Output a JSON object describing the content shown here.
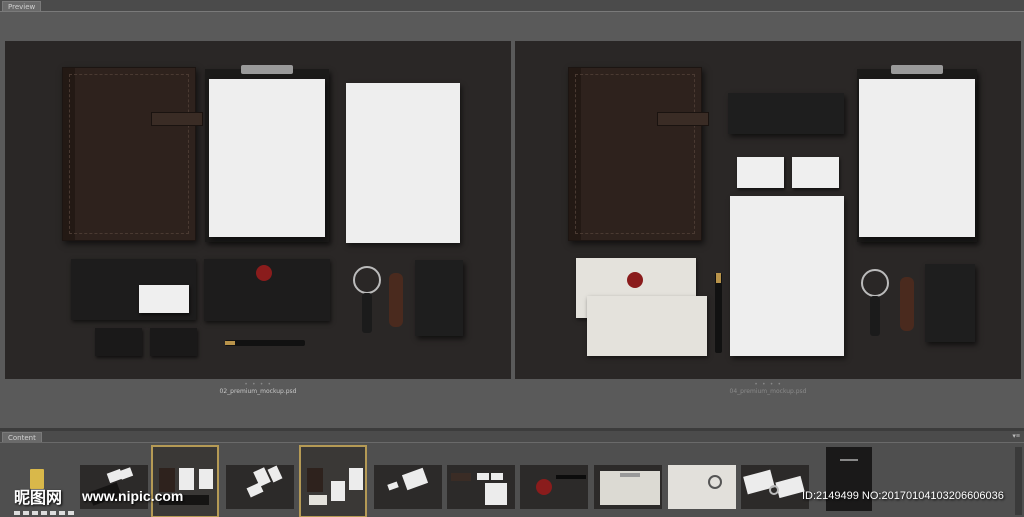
{
  "preview": {
    "tab_label": "Preview",
    "left_caption": "02_premium_mockup.psd",
    "right_caption": "04_premium_mockup.psd",
    "dots": "• • • •"
  },
  "content": {
    "tab_label": "Content",
    "panel_buttons": "▾≡",
    "thumbnails": [
      {
        "selected": false
      },
      {
        "selected": true
      },
      {
        "selected": false
      },
      {
        "selected": true
      },
      {
        "selected": false
      },
      {
        "selected": false
      },
      {
        "selected": false
      },
      {
        "selected": false
      },
      {
        "selected": false
      },
      {
        "selected": false
      },
      {
        "selected": false
      }
    ]
  },
  "watermark": {
    "logo": "昵图网",
    "url": "www.nipic.com",
    "id_text": "ID:2149499 NO:20170104103206606036"
  },
  "colors": {
    "panel_bg": "#5a5a5a",
    "mockup_bg": "#2a2726",
    "selection_border": "#b59a55",
    "seal": "#8a1c1c",
    "leather": "#2e221d"
  }
}
